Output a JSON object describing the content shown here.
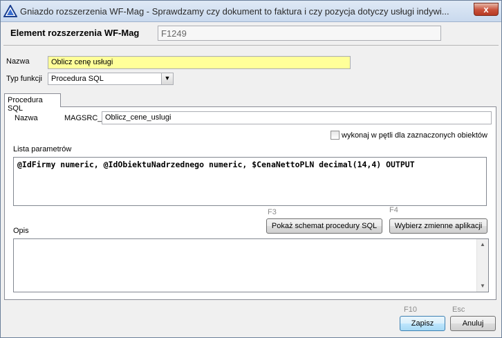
{
  "window": {
    "title": "Gniazdo rozszerzenia WF-Mag - Sprawdzamy czy dokument to faktura i czy pozycja dotyczy usługi indywi...",
    "close_label": "x"
  },
  "header": {
    "label": "Element rozszerzenia WF-Mag",
    "code": "F1249"
  },
  "form": {
    "name_label": "Nazwa",
    "name_value": "Oblicz cenę usługi",
    "type_label": "Typ funkcji",
    "type_value": "Procedura SQL"
  },
  "tab": {
    "label": "Procedura SQL",
    "name_label": "Nazwa",
    "prefix": "MAGSRC_",
    "procedure_name": "Oblicz_cene_uslugi",
    "loop_checkbox_label": "wykonaj w pętli dla zaznaczonych obiektów",
    "loop_checked": false,
    "params_label": "Lista parametrów",
    "params_value": "@IdFirmy numeric, @IdObiektuNadrzednego numeric, $CenaNettoPLN decimal(14,4) OUTPUT",
    "schema_shortcut": "F3",
    "schema_button": "Pokaż schemat procedury SQL",
    "variables_shortcut": "F4",
    "variables_button": "Wybierz zmienne aplikacji",
    "description_label": "Opis",
    "description_value": ""
  },
  "footer": {
    "save_shortcut": "F10",
    "save_button": "Zapisz",
    "cancel_shortcut": "Esc",
    "cancel_button": "Anuluj"
  },
  "colors": {
    "highlight_field": "#ffff99",
    "titlebar": "#c9d9ee",
    "close_button": "#c8503a"
  }
}
